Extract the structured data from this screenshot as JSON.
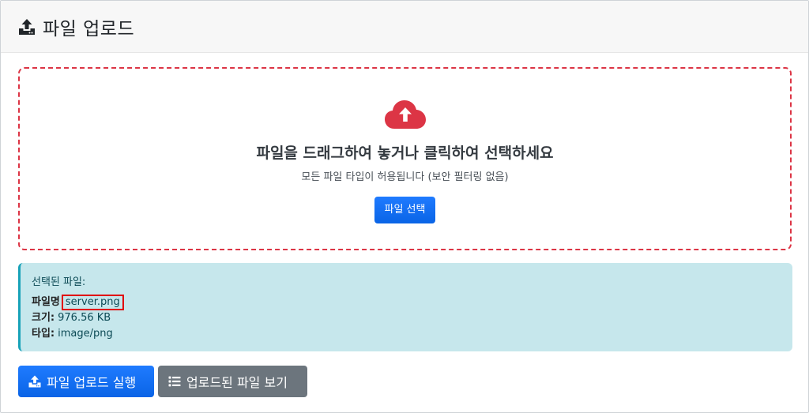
{
  "header": {
    "title": "파일 업로드",
    "icon": "upload-icon"
  },
  "dropzone": {
    "icon": "cloud-upload-icon",
    "main_text": "파일을 드래그하여 놓거나 클릭하여 선택하세요",
    "sub_text": "모든 파일 타입이 허용됩니다 (보안 필터링 없음)",
    "select_button": "파일 선택",
    "border_color": "#dc3545",
    "icon_color": "#dc3545"
  },
  "file_info": {
    "heading": "선택된 파일:",
    "name_label": "파일명",
    "name_value": "server.png",
    "size_label": "크기:",
    "size_value": "976.56 KB",
    "type_label": "타입:",
    "type_value": "image/png"
  },
  "actions": {
    "upload_button": "파일 업로드 실행",
    "upload_icon": "upload-icon",
    "view_button": "업로드된 파일 보기",
    "view_icon": "list-icon"
  },
  "colors": {
    "primary": "#0d6efd",
    "secondary": "#6c757d",
    "info_bg": "#c6e7ec",
    "info_border": "#17a2b8",
    "highlight": "#e00000"
  }
}
